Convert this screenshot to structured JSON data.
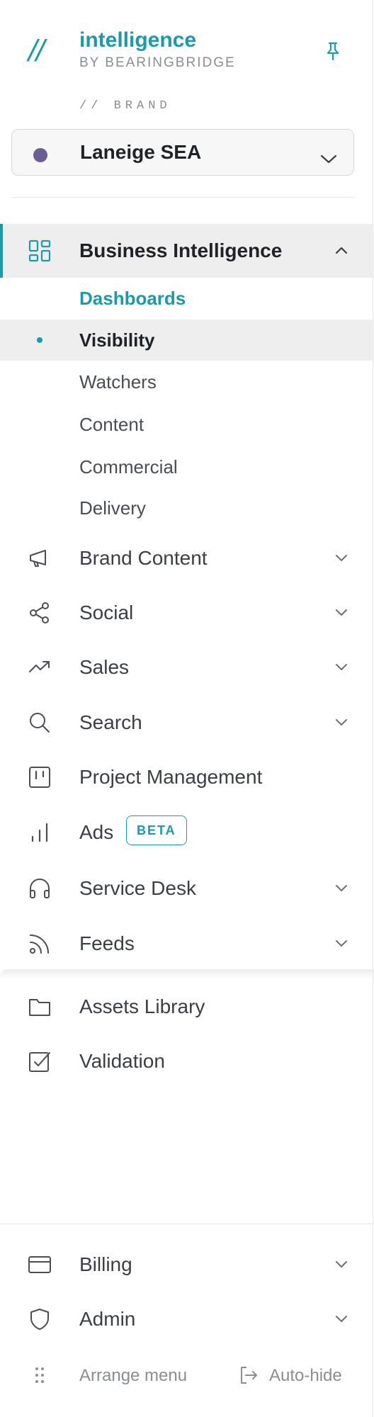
{
  "header": {
    "logo": "//",
    "app_name": "intelligence",
    "app_sub": "BY BEARINGBRIDGE",
    "pin_icon": "pin-icon"
  },
  "brand": {
    "kicker": "// BRAND",
    "selected": "Laneige SEA",
    "dot_color": "#6b5e94"
  },
  "nav": {
    "business_intelligence": {
      "label": "Business Intelligence",
      "icon": "dashboard-grid-icon",
      "expanded": true,
      "children": [
        "Dashboards",
        "Visibility",
        "Watchers",
        "Content",
        "Commercial",
        "Delivery"
      ]
    },
    "brand_content": {
      "label": "Brand Content",
      "icon": "megaphone-icon"
    },
    "social": {
      "label": "Social",
      "icon": "share-icon"
    },
    "sales": {
      "label": "Sales",
      "icon": "trending-up-icon"
    },
    "search": {
      "label": "Search",
      "icon": "search-icon"
    },
    "project_management": {
      "label": "Project Management",
      "icon": "kanban-icon"
    },
    "ads": {
      "label": "Ads",
      "icon": "bar-chart-icon",
      "badge": "BETA"
    },
    "service_desk": {
      "label": "Service Desk",
      "icon": "headphones-icon"
    },
    "feeds": {
      "label": "Feeds",
      "icon": "rss-icon"
    },
    "assets_library": {
      "label": "Assets Library",
      "icon": "folder-icon"
    },
    "validation": {
      "label": "Validation",
      "icon": "checkbox-icon"
    },
    "billing": {
      "label": "Billing",
      "icon": "credit-card-icon"
    },
    "admin": {
      "label": "Admin",
      "icon": "shield-icon"
    }
  },
  "footer": {
    "arrange": "Arrange menu",
    "autohide": "Auto-hide"
  },
  "colors": {
    "accent": "#1b9aaa",
    "active_bg": "#eeeeee",
    "text": "#3b3f45",
    "muted": "#8a8d92"
  }
}
